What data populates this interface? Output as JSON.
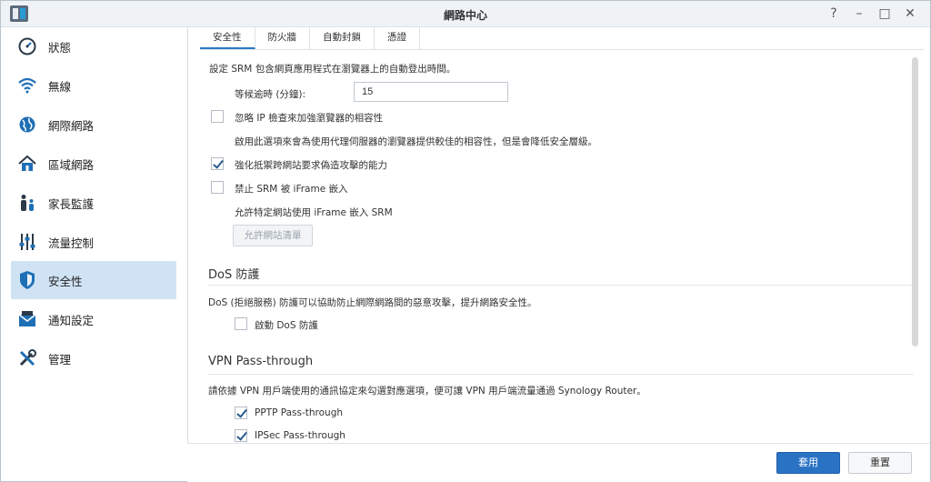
{
  "window": {
    "title": "網路中心",
    "controls": [
      "?",
      "–",
      "□",
      "✕"
    ]
  },
  "sidebar": {
    "items": [
      {
        "label": "狀態",
        "icon": "status-icon"
      },
      {
        "label": "無線",
        "icon": "wifi-icon"
      },
      {
        "label": "網際網路",
        "icon": "globe-icon"
      },
      {
        "label": "區域網路",
        "icon": "home-icon"
      },
      {
        "label": "家長監護",
        "icon": "family-icon"
      },
      {
        "label": "流量控制",
        "icon": "sliders-icon"
      },
      {
        "label": "安全性",
        "icon": "shield-icon",
        "active": true
      },
      {
        "label": "通知設定",
        "icon": "notification-icon"
      },
      {
        "label": "管理",
        "icon": "tools-icon"
      }
    ]
  },
  "tabs": [
    {
      "label": "安全性",
      "active": true
    },
    {
      "label": "防火牆"
    },
    {
      "label": "自動封鎖"
    },
    {
      "label": "憑證"
    }
  ],
  "security": {
    "logout_desc": "設定 SRM 包含網頁應用程式在瀏覽器上的自動登出時間。",
    "timeout_label": "等候逾時 (分鐘):",
    "timeout_value": "15",
    "ignore_ip_label": "忽略 IP 檢查來加強瀏覽器的相容性",
    "ignore_ip_checked": false,
    "ignore_ip_desc": "啟用此選項來會為使用代理伺服器的瀏覽器提供較佳的相容性，但是會降低安全層級。",
    "anti_spoof_label": "強化抵禦跨網站要求偽造攻擊的能力",
    "anti_spoof_checked": true,
    "iframe_label": "禁止 SRM 被 iFrame 嵌入",
    "iframe_checked": false,
    "iframe_desc": "允許特定網站使用 iFrame 嵌入 SRM",
    "allowed_sites_button": "允許網站清單"
  },
  "dos": {
    "title": "DoS 防護",
    "desc": "DoS (拒絕服務) 防護可以協助防止網際網路間的惡意攻擊，提升網路安全性。",
    "enable_label": "啟動 DoS 防護",
    "enable_checked": false
  },
  "vpn": {
    "title": "VPN Pass-through",
    "desc": "請依據 VPN 用戶端使用的通訊協定來勾選對應選項，便可讓 VPN 用戶端流量通過 Synology Router。",
    "pptp_label": "PPTP Pass-through",
    "pptp_checked": true,
    "ipsec_label": "IPSec Pass-through",
    "ipsec_checked": true
  },
  "footer": {
    "apply_label": "套用",
    "reset_label": "重置"
  },
  "colors": {
    "accent": "#2a72c4",
    "active_bg": "#cfe3f4",
    "icon_blue": "#1f6fb5"
  }
}
